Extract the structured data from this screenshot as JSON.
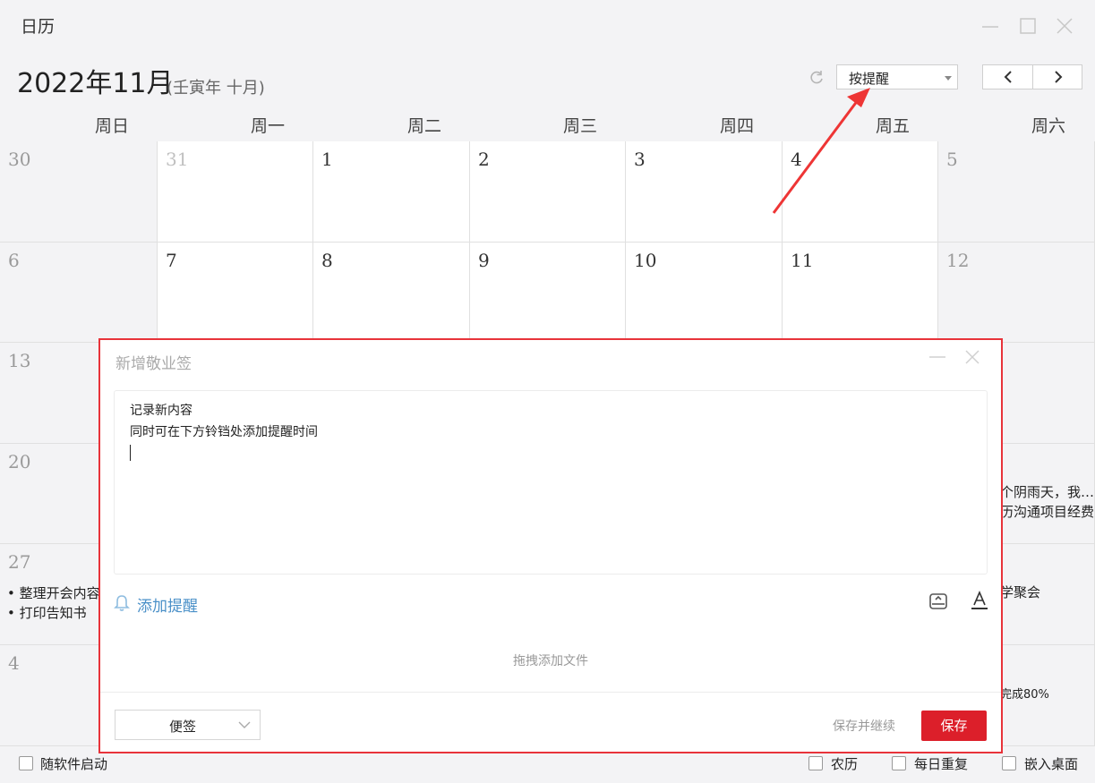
{
  "window": {
    "title": "日历"
  },
  "header": {
    "month_title": "2022年11月",
    "lunar": "(壬寅年 十月)",
    "mode_select": "按提醒"
  },
  "weekdays": [
    "周日",
    "周一",
    "周二",
    "周三",
    "周四",
    "周五",
    "周六"
  ],
  "weeks": [
    [
      "30",
      "31",
      "1",
      "2",
      "3",
      "4",
      "5"
    ],
    [
      "6",
      "7",
      "8",
      "9",
      "10",
      "11",
      "12"
    ],
    [
      "13"
    ],
    [
      "20"
    ],
    [
      "27"
    ],
    [
      "4"
    ]
  ],
  "events": {
    "w27_sun_1": "整理开会内容",
    "w27_sun_2": "打印告知书",
    "w20_sat_1": "个阴雨天，我…",
    "w20_sat_2": "历沟通项目经费",
    "w27_sat_1": "学聚会",
    "w4_sat_1": "完成80%"
  },
  "dialog": {
    "title": "新增敬业签",
    "content_line1": "记录新内容",
    "content_line2": "同时可在下方铃铛处添加提醒时间",
    "add_reminder": "添加提醒",
    "drop_hint": "拖拽添加文件",
    "type_select": "便签",
    "save_continue": "保存并继续",
    "save": "保存"
  },
  "bottom": {
    "startup": "随软件启动",
    "lunar": "农历",
    "repeat": "每日重复",
    "embed": "嵌入桌面"
  },
  "colors": {
    "accent": "#dc1f2a",
    "link": "#4a90c8",
    "highlight": "#e8333a"
  }
}
